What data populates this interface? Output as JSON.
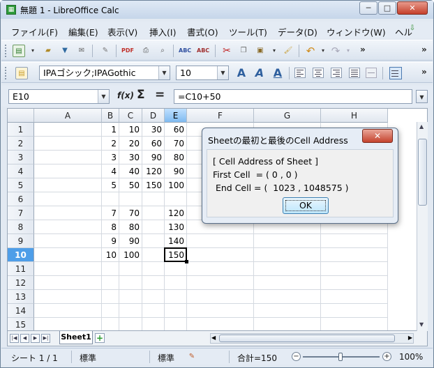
{
  "window": {
    "title": "無題 1 - LibreOffice Calc",
    "min": "─",
    "max": "□",
    "close": "✕"
  },
  "menu": [
    "ファイル(F)",
    "編集(E)",
    "表示(V)",
    "挿入(I)",
    "書式(O)",
    "ツール(T)",
    "データ(D)",
    "ウィンドウ(W)",
    "ヘル"
  ],
  "toolbar": {
    "more": "»",
    "font_name": "IPAゴシック;IPAGothic",
    "font_size": "10",
    "bold": "A",
    "italic": "A",
    "underline": "A"
  },
  "formula_bar": {
    "name_box": "E10",
    "formula": "=C10+50",
    "fx": "f(x)",
    "sum": "Σ",
    "equals": "="
  },
  "columns": [
    "A",
    "B",
    "C",
    "D",
    "E",
    "F",
    "G",
    "H"
  ],
  "rows": [
    "1",
    "2",
    "3",
    "4",
    "5",
    "6",
    "7",
    "8",
    "9",
    "10",
    "11",
    "12",
    "13",
    "14",
    "15"
  ],
  "active": {
    "col": "E",
    "row": "10"
  },
  "cells": {
    "r1": {
      "B": "1",
      "C": "10",
      "D": "30",
      "E": "60"
    },
    "r2": {
      "B": "2",
      "C": "20",
      "D": "60",
      "E": "70"
    },
    "r3": {
      "B": "3",
      "C": "30",
      "D": "90",
      "E": "80"
    },
    "r4": {
      "B": "4",
      "C": "40",
      "D": "120",
      "E": "90"
    },
    "r5": {
      "B": "5",
      "C": "50",
      "D": "150",
      "E": "100"
    },
    "r7": {
      "B": "7",
      "C": "70",
      "E": "120"
    },
    "r8": {
      "B": "8",
      "C": "80",
      "E": "130"
    },
    "r9": {
      "B": "9",
      "C": "90",
      "E": "140"
    },
    "r10": {
      "B": "10",
      "C": "100",
      "E": "150"
    }
  },
  "sheet_tab": "Sheet1",
  "status": {
    "sheet": "シート 1 / 1",
    "style": "標準",
    "mode": "標準",
    "sum": "合計=150",
    "zoom": "100%",
    "zoom_level_percent": 100
  },
  "dialog": {
    "title": "Sheetの最初と最後のCell Address",
    "close": "✕",
    "line1": "[ Cell Address of Sheet ]",
    "line2": "First Cell  = ( 0 , 0 )",
    "line3": " End Cell = (  1023 , 1048575 )",
    "ok": "OK"
  }
}
